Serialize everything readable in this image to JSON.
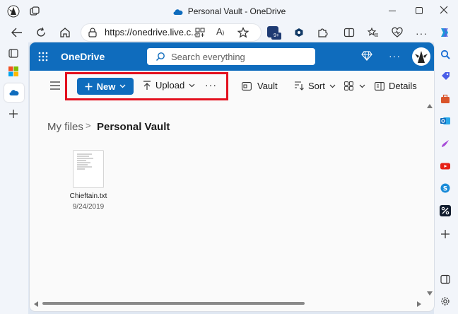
{
  "window": {
    "title": "Personal Vault - OneDrive"
  },
  "browser": {
    "url": "https://onedrive.live.c...",
    "reader_label": "A",
    "extension_badge": "9+"
  },
  "onedrive": {
    "brand": "OneDrive",
    "search_placeholder": "Search everything"
  },
  "toolbar": {
    "new_label": "New",
    "upload_label": "Upload",
    "more_label": "···",
    "vault_label": "Vault",
    "sort_label": "Sort",
    "details_label": "Details"
  },
  "breadcrumb": {
    "root": "My files",
    "separator": ">",
    "current": "Personal Vault"
  },
  "files": [
    {
      "name": "Chieftain.txt",
      "date": "9/24/2019"
    }
  ],
  "colors": {
    "accent": "#0f6cbd",
    "highlight": "#e3101e"
  }
}
